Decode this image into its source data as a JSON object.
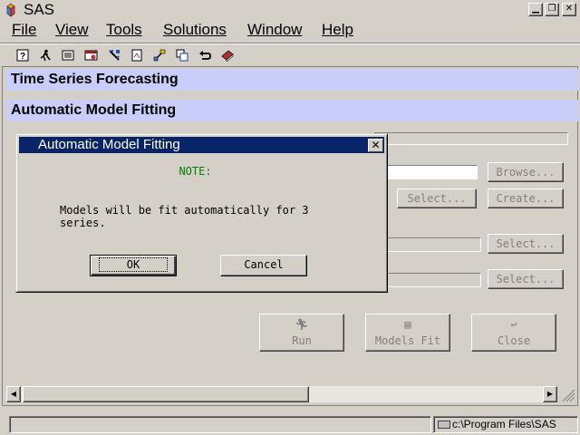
{
  "window": {
    "title": "SAS"
  },
  "menu": [
    "File",
    "View",
    "Tools",
    "Solutions",
    "Window",
    "Help"
  ],
  "toolbar": {
    "icons": [
      "help-icon",
      "run-icon",
      "list-icon",
      "window-icon",
      "tools-icon",
      "document-icon",
      "explorer-icon",
      "copy-icon",
      "undo-icon",
      "book-icon"
    ]
  },
  "main": {
    "banner1": "Time Series Forecasting",
    "banner2": "Automatic Model Fitting",
    "buttons": {
      "browse": "Browse...",
      "select1": "Select...",
      "create": "Create...",
      "select2": "Select...",
      "select3": "Select...",
      "run": "Run",
      "models_fit": "Models Fit",
      "close": "Close"
    }
  },
  "dialog": {
    "title": "Automatic Model Fitting",
    "note": "NOTE:",
    "message": "Models will be fit automatically for 3\nseries.",
    "ok": "OK",
    "cancel": "Cancel"
  },
  "status": {
    "path": "c:\\Program Files\\SAS"
  },
  "colors": {
    "banner": "#c8cef7",
    "dialog_title": "#0a246a",
    "note": "#008000"
  }
}
